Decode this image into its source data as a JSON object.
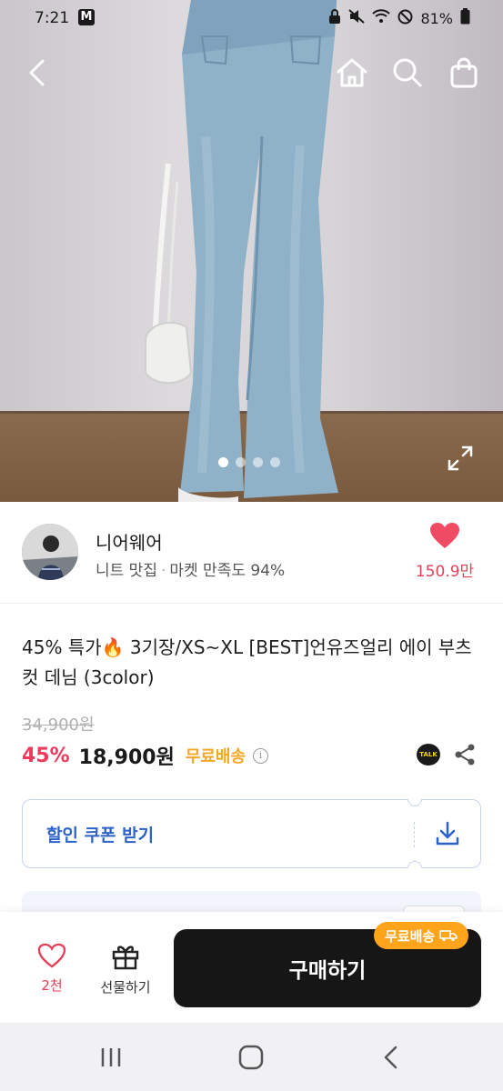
{
  "status_bar": {
    "time": "7:21",
    "notification_icon": "M",
    "battery": "81%",
    "icons": [
      "lock-icon",
      "mute-icon",
      "wifi-icon",
      "dnd-icon",
      "battery-icon"
    ]
  },
  "top_nav": {
    "icons": [
      "back-arrow-icon",
      "home-icon",
      "search-icon",
      "shopping-bag-icon"
    ]
  },
  "gallery": {
    "slide_count": 4,
    "active_slide": 1
  },
  "seller": {
    "name": "니어웨어",
    "category": "니트 맛집",
    "satisfaction": "마켓 만족도 94%",
    "favorite_count": "150.9만"
  },
  "product": {
    "title": "45% 특가🔥 3기장/XS~XL [BEST]언유즈얼리 에이 부츠컷 데님 (3color)",
    "original_price": "34,900원",
    "discount": "45%",
    "price": "18,900원",
    "shipping": "무료배송",
    "talk_label": "TALK"
  },
  "coupon": {
    "label": "할인 쿠폰 받기"
  },
  "action_bar": {
    "like_count": "2천",
    "gift_label": "선물하기",
    "buy_label": "구매하기",
    "shipping_badge": "무료배송"
  },
  "colors": {
    "accent_pink": "#e4405a",
    "discount_red": "#ef3a5d",
    "shipping_orange": "#f5a623",
    "coupon_blue": "#2d63c8",
    "buy_button": "#161616"
  }
}
